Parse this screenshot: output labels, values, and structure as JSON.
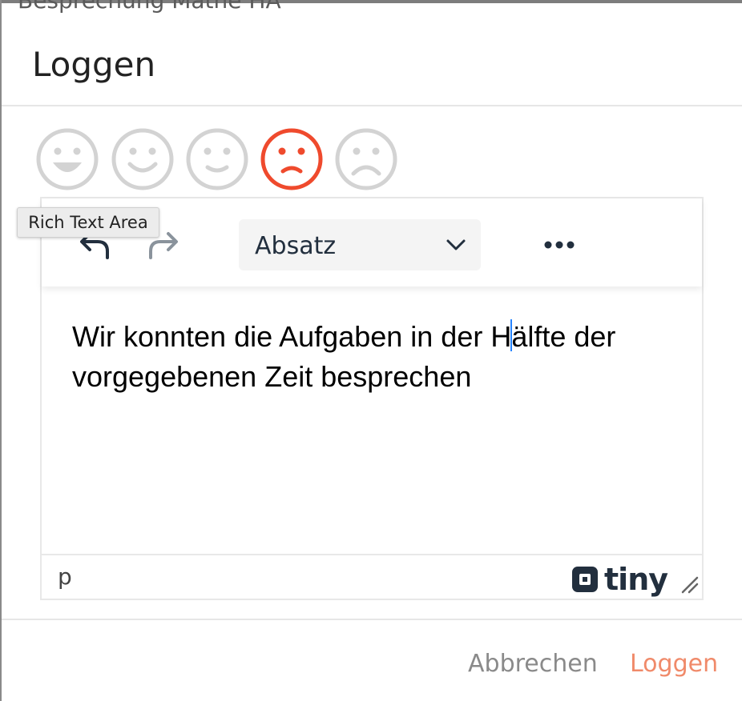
{
  "background_dialog": {
    "title_partial": "Besprechung Mathe HA"
  },
  "dialog": {
    "title": "Loggen"
  },
  "moods": {
    "selected_index": 3,
    "inactive_color": "#d3d3d3",
    "selected_color": "#ef4a2d",
    "items": [
      {
        "icon": "big-grin-icon"
      },
      {
        "icon": "smile-icon"
      },
      {
        "icon": "slight-smile-icon"
      },
      {
        "icon": "slight-frown-icon"
      },
      {
        "icon": "frown-icon"
      }
    ]
  },
  "editor": {
    "tooltip": "Rich Text Area",
    "toolbar": {
      "undo_icon": "undo-icon",
      "redo_icon": "redo-icon",
      "block_format": "Absatz",
      "more_icon": "more-horizontal-icon"
    },
    "content": {
      "before_caret": "Wir konnten die Aufgaben in der H",
      "after_caret": "älfte der vorgegebenen Zeit besprechen"
    },
    "statusbar": {
      "path": "p",
      "brand": "tiny"
    }
  },
  "footer": {
    "cancel_label": "Abbrechen",
    "submit_label": "Loggen",
    "accent_color": "#f08a6a"
  }
}
